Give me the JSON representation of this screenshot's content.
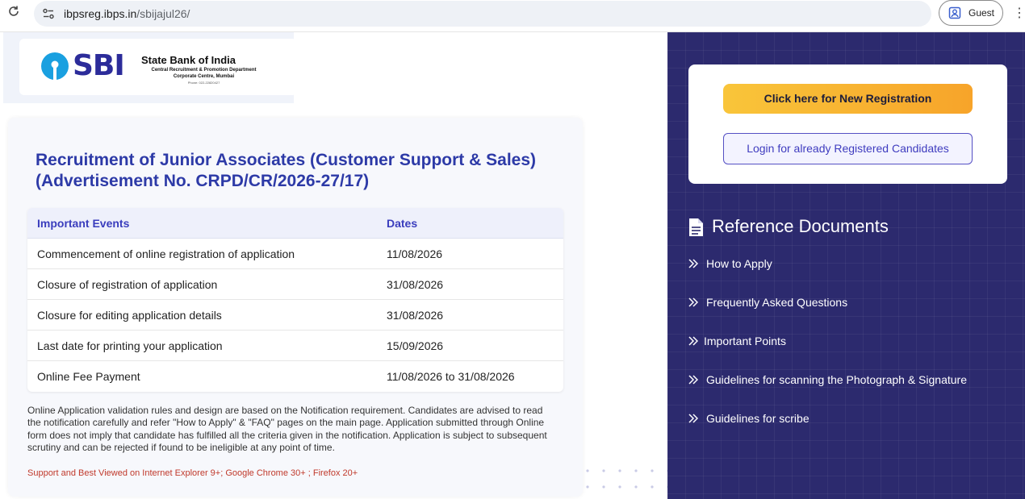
{
  "browser": {
    "url_host": "ibpsreg.ibps.in",
    "url_path": "/sbijajul26/",
    "profile_label": "Guest",
    "icons": [
      "reload-icon",
      "site-info-icon",
      "profile-icon",
      "kebab-menu-icon"
    ]
  },
  "header": {
    "logo_text": "SBI",
    "bank_name": "State Bank of India",
    "department": "Central Recruitment & Promotion Department",
    "location": "Corporate Centre, Mumbai",
    "phone": "Phone: 022-22820427"
  },
  "main": {
    "title": "Recruitment of Junior Associates (Customer Support & Sales) (Advertisement No. CRPD/CR/2026-27/17)",
    "table": {
      "headers": [
        "Important Events",
        "Dates"
      ],
      "rows": [
        [
          "Commencement of online registration of application",
          "11/08/2026"
        ],
        [
          "Closure of registration of application",
          "31/08/2026"
        ],
        [
          "Closure for editing application details",
          "31/08/2026"
        ],
        [
          "Last date for printing your application",
          "15/09/2026"
        ],
        [
          "Online Fee Payment",
          "11/08/2026 to 31/08/2026"
        ]
      ]
    },
    "notice": "Online Application validation rules and design are based on the Notification requirement. Candidates are advised to read the notification carefully and refer \"How to Apply\" & \"FAQ\" pages on the main page. Application submitted through Online form does not imply that candidate has fulfilled all the criteria given in the notification. Application is subject to subsequent scrutiny and can be rejected if found to be ineligible at any point of time.",
    "support": "Support and Best Viewed on Internet Explorer 9+; Google Chrome 30+ ; Firefox 20+"
  },
  "sidebar": {
    "new_registration_label": "Click here for New Registration",
    "login_label": "Login for already Registered Candidates",
    "reference_title": "Reference Documents",
    "reference_items": [
      "How to Apply",
      "Frequently Asked Questions",
      "Important Points",
      "Guidelines for scanning the Photograph & Signature",
      "Guidelines for scribe"
    ]
  },
  "colors": {
    "title_blue": "#2d3aa7",
    "panel_bg": "#2c2a6e",
    "button_yellow": "#f9c53a",
    "button_orange": "#f7a42a",
    "support_red": "#c0392b"
  }
}
